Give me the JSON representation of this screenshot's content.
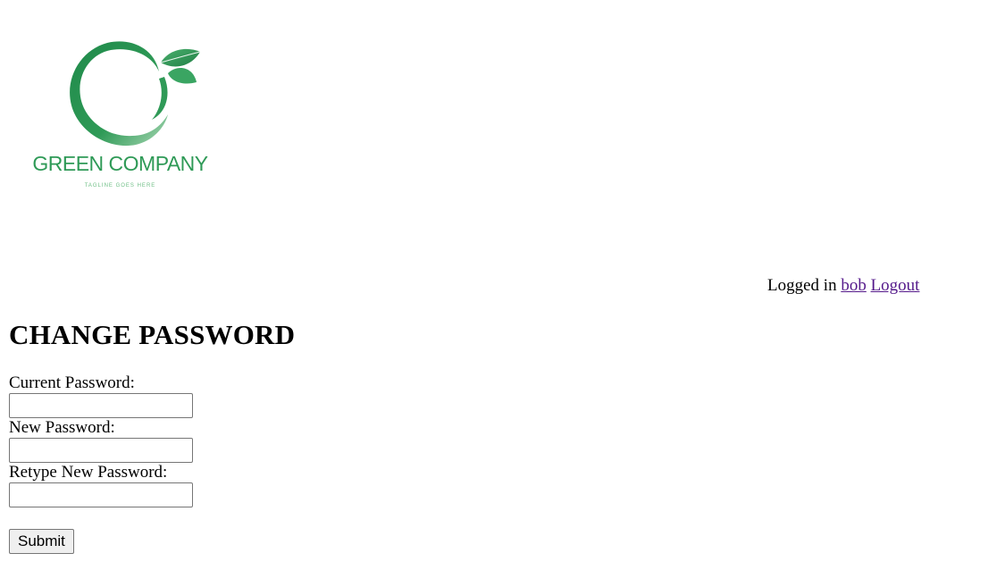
{
  "logo": {
    "company_name": "GREEN COMPANY",
    "tagline": "TAGLINE GOES HERE",
    "icon": "leaf-ring-logo",
    "colors": {
      "primary": "#2f9a57",
      "light": "#6fbf86"
    }
  },
  "session": {
    "prefix": "Logged in",
    "username": "bob",
    "logout_label": "Logout"
  },
  "page": {
    "title": "CHANGE PASSWORD"
  },
  "form": {
    "current_password_label": "Current Password:",
    "current_password_value": "",
    "new_password_label": "New Password:",
    "new_password_value": "",
    "retype_password_label": "Retype New Password:",
    "retype_password_value": "",
    "submit_label": "Submit"
  },
  "colors": {
    "link": "#551a8b",
    "button_bg": "#efefef",
    "input_border": "#767676"
  }
}
